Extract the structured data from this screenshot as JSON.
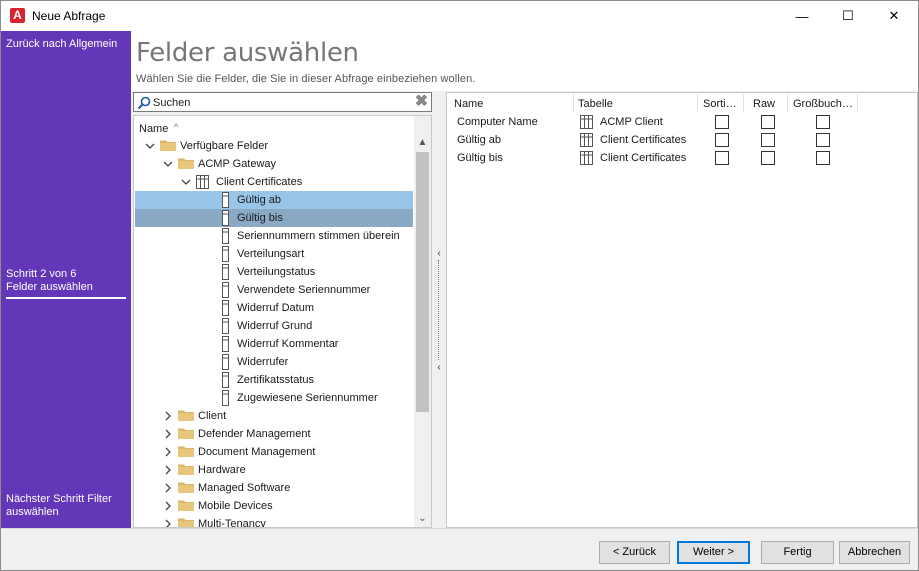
{
  "window": {
    "title": "Neue Abfrage",
    "minimize_glyph": "—",
    "maximize_glyph": "☐",
    "close_glyph": "✕",
    "app_icon_letter": "A"
  },
  "sidebar": {
    "back_link": "Zurück nach Allgemein",
    "step_label": "Schritt 2 von 6",
    "current_step": "Felder auswählen",
    "next_link": "Nächster Schritt Filter auswählen"
  },
  "header": {
    "title": "Felder auswählen",
    "subtitle": "Wählen Sie die Felder, die Sie in dieser Abfrage einbeziehen wollen."
  },
  "search": {
    "value": "Suchen",
    "clear_glyph": "✖"
  },
  "tree": {
    "column_header": "Name",
    "sort_glyph": "^",
    "nodes": [
      {
        "label": "Verfügbare Felder",
        "type": "folder",
        "expander": "⌄"
      },
      {
        "label": "ACMP Gateway",
        "type": "folder",
        "expander": "⌄"
      },
      {
        "label": "Client Certificates",
        "type": "table",
        "expander": "⌄"
      },
      {
        "label": "Gültig ab",
        "type": "field",
        "selected": "selected-light"
      },
      {
        "label": "Gültig bis",
        "type": "field",
        "selected": "selected-dark"
      },
      {
        "label": "Seriennummern stimmen überein",
        "type": "field"
      },
      {
        "label": "Verteilungsart",
        "type": "field"
      },
      {
        "label": "Verteilungstatus",
        "type": "field"
      },
      {
        "label": "Verwendete Seriennummer",
        "type": "field"
      },
      {
        "label": "Widerruf Datum",
        "type": "field"
      },
      {
        "label": "Widerruf Grund",
        "type": "field"
      },
      {
        "label": "Widerruf Kommentar",
        "type": "field"
      },
      {
        "label": "Widerrufer",
        "type": "field"
      },
      {
        "label": "Zertifikatsstatus",
        "type": "field"
      },
      {
        "label": "Zugewiesene Seriennummer",
        "type": "field"
      },
      {
        "label": "Client",
        "type": "folder",
        "expander": "›"
      },
      {
        "label": "Defender Management",
        "type": "folder",
        "expander": "›"
      },
      {
        "label": "Document Management",
        "type": "folder",
        "expander": "›"
      },
      {
        "label": "Hardware",
        "type": "folder",
        "expander": "›"
      },
      {
        "label": "Managed Software",
        "type": "folder",
        "expander": "›"
      },
      {
        "label": "Mobile Devices",
        "type": "folder",
        "expander": "›"
      },
      {
        "label": "Multi-Tenancy",
        "type": "folder",
        "expander": "›"
      }
    ],
    "scroll_up_glyph": "▲",
    "scroll_down_glyph": "⌄"
  },
  "splitter": {
    "left_glyph": "‹",
    "right_glyph": "‹"
  },
  "grid": {
    "columns": [
      "Name",
      "Tabelle",
      "Sorti…",
      "Raw",
      "Großbuch…"
    ],
    "rows": [
      {
        "name": "Computer Name",
        "table": "ACMP Client",
        "sort": false,
        "raw": false,
        "upper": false
      },
      {
        "name": "Gültig ab",
        "table": "Client Certificates",
        "sort": false,
        "raw": false,
        "upper": false
      },
      {
        "name": "Gültig bis",
        "table": "Client Certificates",
        "sort": false,
        "raw": false,
        "upper": false
      }
    ]
  },
  "buttons": {
    "back": "< Zurück",
    "next": "Weiter >",
    "finish": "Fertig",
    "cancel": "Abbrechen"
  },
  "colors": {
    "sidebar": "#6436b8",
    "selection_light": "#99c5e9",
    "selection_dark": "#8aa9c5",
    "folder": "#dcb66a",
    "brand": "#d9232e"
  }
}
